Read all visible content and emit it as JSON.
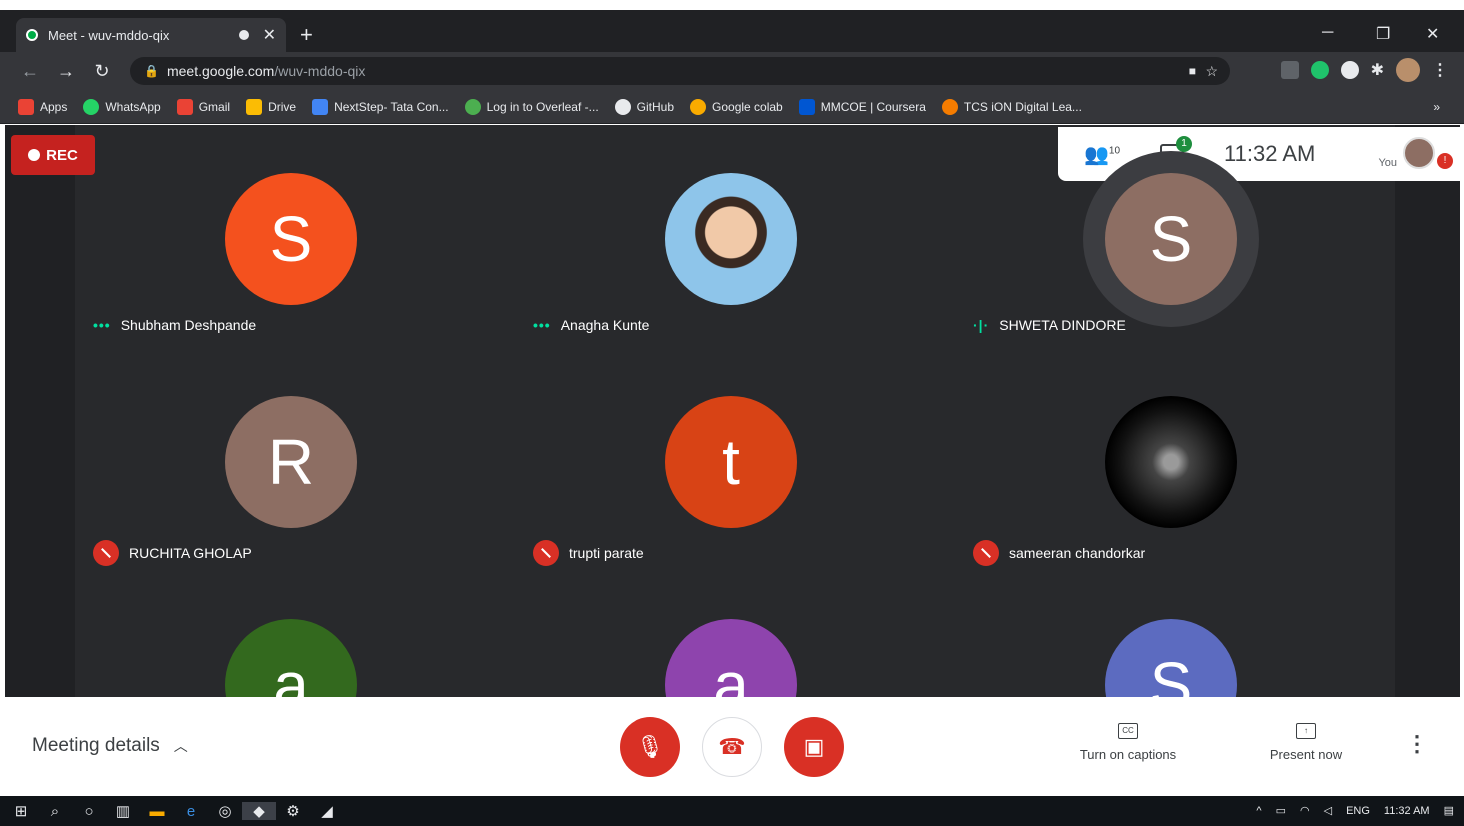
{
  "browser": {
    "tab_title": "Meet - wuv-mddo-qix",
    "url_host": "meet.google.com",
    "url_path": "/wuv-mddo-qix",
    "bookmarks": [
      "Apps",
      "WhatsApp",
      "Gmail",
      "Drive",
      "NextStep- Tata Con...",
      "Log in to Overleaf -...",
      "GitHub",
      "Google colab",
      "MMCOE | Coursera",
      "TCS iON Digital Lea..."
    ]
  },
  "meet": {
    "rec_label": "REC",
    "participants_count": "10",
    "chat_badge": "1",
    "time": "11:32 AM",
    "you_label": "You",
    "participants": [
      {
        "initial": "S",
        "name": "Shubham Deshpande",
        "color": "#f4511e",
        "state": "speaking-dots"
      },
      {
        "initial": "",
        "name": "Anagha Kunte",
        "color": "#8ec5ea",
        "state": "speaking-dots"
      },
      {
        "initial": "S",
        "name": "SHWETA DINDORE",
        "color": "#8d6e63",
        "state": "speaking-bars"
      },
      {
        "initial": "R",
        "name": "RUCHITA GHOLAP",
        "color": "#8d6e63",
        "state": "muted"
      },
      {
        "initial": "t",
        "name": "trupti parate",
        "color": "#d84315",
        "state": "muted"
      },
      {
        "initial": "",
        "name": "sameeran chandorkar",
        "color": "#000000",
        "state": "muted"
      },
      {
        "initial": "a",
        "name": "",
        "color": "#33691e",
        "state": ""
      },
      {
        "initial": "a",
        "name": "",
        "color": "#8e44ad",
        "state": ""
      },
      {
        "initial": "S",
        "name": "",
        "color": "#5c6bc0",
        "state": ""
      }
    ]
  },
  "controls": {
    "meeting_details": "Meeting details",
    "captions": "Turn on captions",
    "present": "Present now"
  },
  "taskbar": {
    "lang": "ENG",
    "time": "11:32 AM"
  }
}
